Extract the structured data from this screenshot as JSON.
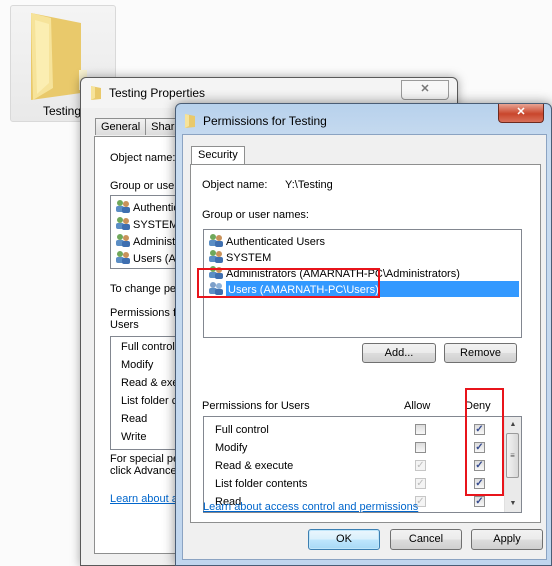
{
  "desktop": {
    "folder_label": "Testing",
    "folder_icon": "folder-icon"
  },
  "properties_window": {
    "title": "Testing Properties",
    "close_glyph": "✕",
    "tabs": [
      {
        "label": "General"
      },
      {
        "label": "Shar"
      }
    ],
    "object_name_label": "Object name:",
    "group_label": "Group or user",
    "groups": [
      {
        "name": "Authentic"
      },
      {
        "name": "SYSTEM"
      },
      {
        "name": "Administr"
      },
      {
        "name": "Users (Al"
      }
    ],
    "change_text": "To change pe",
    "permissions_for_label_1": "Permissions fo",
    "permissions_for_label_2": "Users",
    "permissions": [
      {
        "name": "Full control"
      },
      {
        "name": "Modify"
      },
      {
        "name": "Read & exe"
      },
      {
        "name": "List folder c"
      },
      {
        "name": "Read"
      },
      {
        "name": "Write"
      }
    ],
    "special_text_1": "For special pe",
    "special_text_2": "click Advance",
    "learn_link": "Learn about a"
  },
  "permissions_window": {
    "title": "Permissions for Testing",
    "close_glyph": "✕",
    "tab_label": "Security",
    "object_name_label": "Object name:",
    "object_name_value": "Y:\\Testing",
    "group_label": "Group or user names:",
    "groups": [
      {
        "name": "Authenticated Users",
        "selected": false
      },
      {
        "name": "SYSTEM",
        "selected": false
      },
      {
        "name": "Administrators (AMARNATH-PC\\Administrators)",
        "selected": false
      },
      {
        "name": "Users (AMARNATH-PC\\Users)",
        "selected": true
      }
    ],
    "add_button": "Add...",
    "remove_button": "Remove",
    "permissions_header": "Permissions for Users",
    "allow_header": "Allow",
    "deny_header": "Deny",
    "permissions": [
      {
        "name": "Full control",
        "allow": false,
        "allow_disabled": false,
        "deny": true
      },
      {
        "name": "Modify",
        "allow": false,
        "allow_disabled": false,
        "deny": true
      },
      {
        "name": "Read & execute",
        "allow": true,
        "allow_disabled": true,
        "deny": true
      },
      {
        "name": "List folder contents",
        "allow": true,
        "allow_disabled": true,
        "deny": true
      },
      {
        "name": "Read",
        "allow": true,
        "allow_disabled": true,
        "deny": true
      }
    ],
    "check_glyph": "✓",
    "learn_link": "Learn about access control and permissions",
    "ok_button": "OK",
    "cancel_button": "Cancel",
    "apply_button": "Apply"
  },
  "annotation_color": "#e8141b",
  "selection_color": "#3399ff"
}
